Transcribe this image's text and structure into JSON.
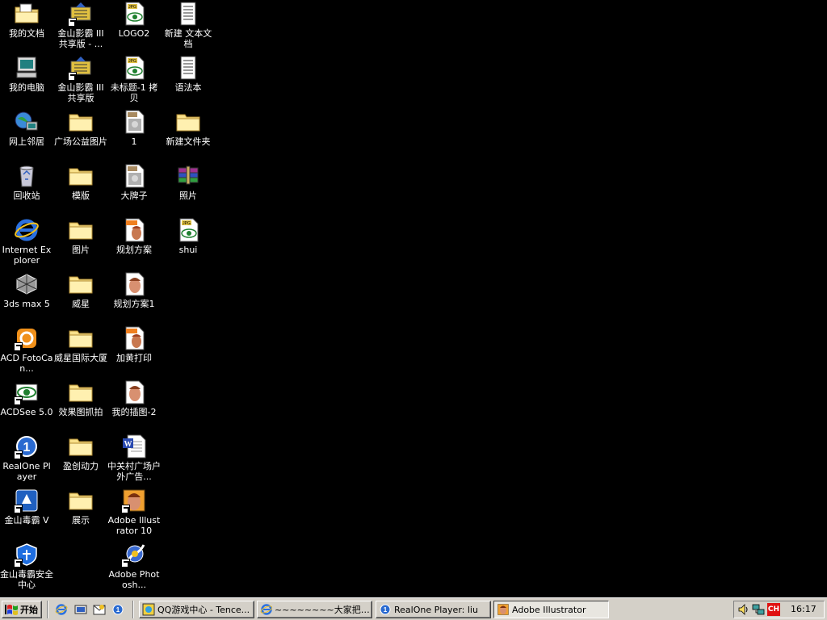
{
  "colors": {
    "desktop": "#000000",
    "taskbar": "#d4d0c8",
    "active_task": "#e8e6e0",
    "ime": "#e01010"
  },
  "desktop": {
    "icons": [
      {
        "label": "我的文档",
        "icon": "my-documents-icon",
        "shortcut": false
      },
      {
        "label": "我的电脑",
        "icon": "my-computer-icon",
        "shortcut": false
      },
      {
        "label": "网上邻居",
        "icon": "network-neighborhood-icon",
        "shortcut": false
      },
      {
        "label": "回收站",
        "icon": "recycle-bin-icon",
        "shortcut": false
      },
      {
        "label": "Internet Explorer",
        "icon": "internet-explorer-icon",
        "shortcut": false
      },
      {
        "label": "3ds max 5",
        "icon": "3ds-max-icon",
        "shortcut": false
      },
      {
        "label": "ACD FotoCan...",
        "icon": "acd-fotocanvas-icon",
        "shortcut": true
      },
      {
        "label": "ACDSee 5.0",
        "icon": "acdsee-icon",
        "shortcut": true
      },
      {
        "label": "RealOne Player",
        "icon": "realone-player-icon",
        "shortcut": true
      },
      {
        "label": "金山毒霸 V",
        "icon": "kingsoft-antivirus-icon",
        "shortcut": true
      },
      {
        "label": "金山毒霸安全中心",
        "icon": "kingsoft-security-center-icon",
        "shortcut": true
      },
      {
        "label": "金山影霸 III 共享版 - ...",
        "icon": "kingsoft-player-icon",
        "shortcut": true
      },
      {
        "label": "金山影霸 III 共享版",
        "icon": "kingsoft-player-icon",
        "shortcut": true
      },
      {
        "label": "广场公益图片",
        "icon": "folder-icon",
        "shortcut": false
      },
      {
        "label": "模版",
        "icon": "folder-icon",
        "shortcut": false
      },
      {
        "label": "图片",
        "icon": "folder-icon",
        "shortcut": false
      },
      {
        "label": "威星",
        "icon": "folder-icon",
        "shortcut": false
      },
      {
        "label": "威星国际大厦",
        "icon": "folder-icon",
        "shortcut": false
      },
      {
        "label": "效果图抓拍",
        "icon": "folder-icon",
        "shortcut": false
      },
      {
        "label": "盈创动力",
        "icon": "folder-icon",
        "shortcut": false
      },
      {
        "label": "展示",
        "icon": "folder-icon",
        "shortcut": false
      },
      {
        "label": "LOGO2",
        "icon": "jpg-file-icon",
        "shortcut": false
      },
      {
        "label": "未标题-1 拷贝",
        "icon": "jpg-file-icon",
        "shortcut": false
      },
      {
        "label": "1",
        "icon": "image-file-icon",
        "shortcut": false
      },
      {
        "label": "大牌子",
        "icon": "image-file-icon",
        "shortcut": false
      },
      {
        "label": "规划方案",
        "icon": "illustrator-file-icon",
        "shortcut": false
      },
      {
        "label": "规划方案1",
        "icon": "venus-file-icon",
        "shortcut": false
      },
      {
        "label": "加黄打印",
        "icon": "illustrator-file-icon",
        "shortcut": false
      },
      {
        "label": "我的插图-2",
        "icon": "venus-file-icon",
        "shortcut": false
      },
      {
        "label": "中关村广场户外广告...",
        "icon": "word-document-icon",
        "shortcut": false
      },
      {
        "label": "Adobe Illustrator 10",
        "icon": "adobe-illustrator-icon",
        "shortcut": true
      },
      {
        "label": "Adobe Photosh...",
        "icon": "adobe-photoshop-icon",
        "shortcut": true
      },
      {
        "label": "新建 文本文档",
        "icon": "text-document-icon",
        "shortcut": false
      },
      {
        "label": "语法本",
        "icon": "text-document-icon",
        "shortcut": false
      },
      {
        "label": "新建文件夹",
        "icon": "folder-icon",
        "shortcut": false
      },
      {
        "label": "照片",
        "icon": "winrar-archive-icon",
        "shortcut": false
      },
      {
        "label": "shui",
        "icon": "jpg-file-icon",
        "shortcut": false
      }
    ]
  },
  "taskbar": {
    "start_label": "开始",
    "quick_launch": [
      {
        "icon": "internet-explorer-icon"
      },
      {
        "icon": "show-desktop-icon"
      },
      {
        "icon": "outlook-express-icon"
      },
      {
        "icon": "realone-quicklaunch-icon"
      }
    ],
    "tasks": [
      {
        "label": "QQ游戏中心 - Tence...",
        "icon": "qq-game-icon",
        "active": false
      },
      {
        "label": "~~~~~~~~大家把自...",
        "icon": "internet-explorer-icon",
        "active": false
      },
      {
        "label": "RealOne Player: liu",
        "icon": "realone-player-icon",
        "active": false
      },
      {
        "label": "Adobe Illustrator",
        "icon": "adobe-illustrator-icon",
        "active": true
      }
    ],
    "tray": {
      "ime": "CH",
      "clock": "16:17"
    }
  }
}
